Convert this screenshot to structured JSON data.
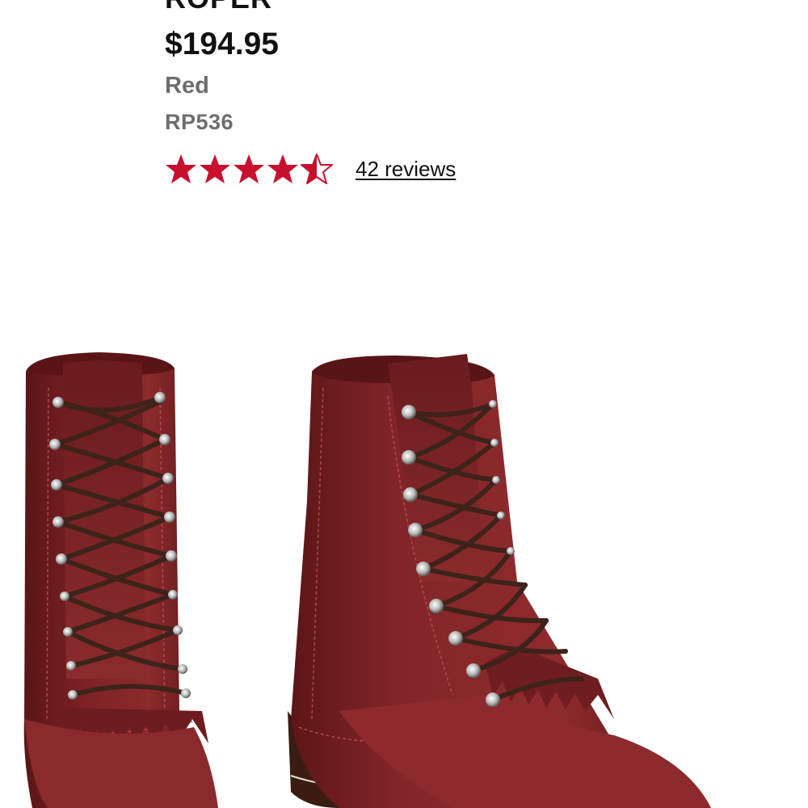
{
  "product": {
    "title": "ROPER",
    "price": "$194.95",
    "color": "Red",
    "sku": "RP536",
    "rating": 4.5,
    "rating_max": 5,
    "reviews_label": "42 reviews"
  },
  "colors": {
    "star": "#c8102e",
    "text": "#111111",
    "muted": "#6e6e6e",
    "leather": "#7a1f22",
    "lace": "#3d231a"
  },
  "icons": {
    "star_full": "star-icon",
    "star_half": "star-half-icon"
  },
  "image": {
    "subject": "product-photo"
  }
}
